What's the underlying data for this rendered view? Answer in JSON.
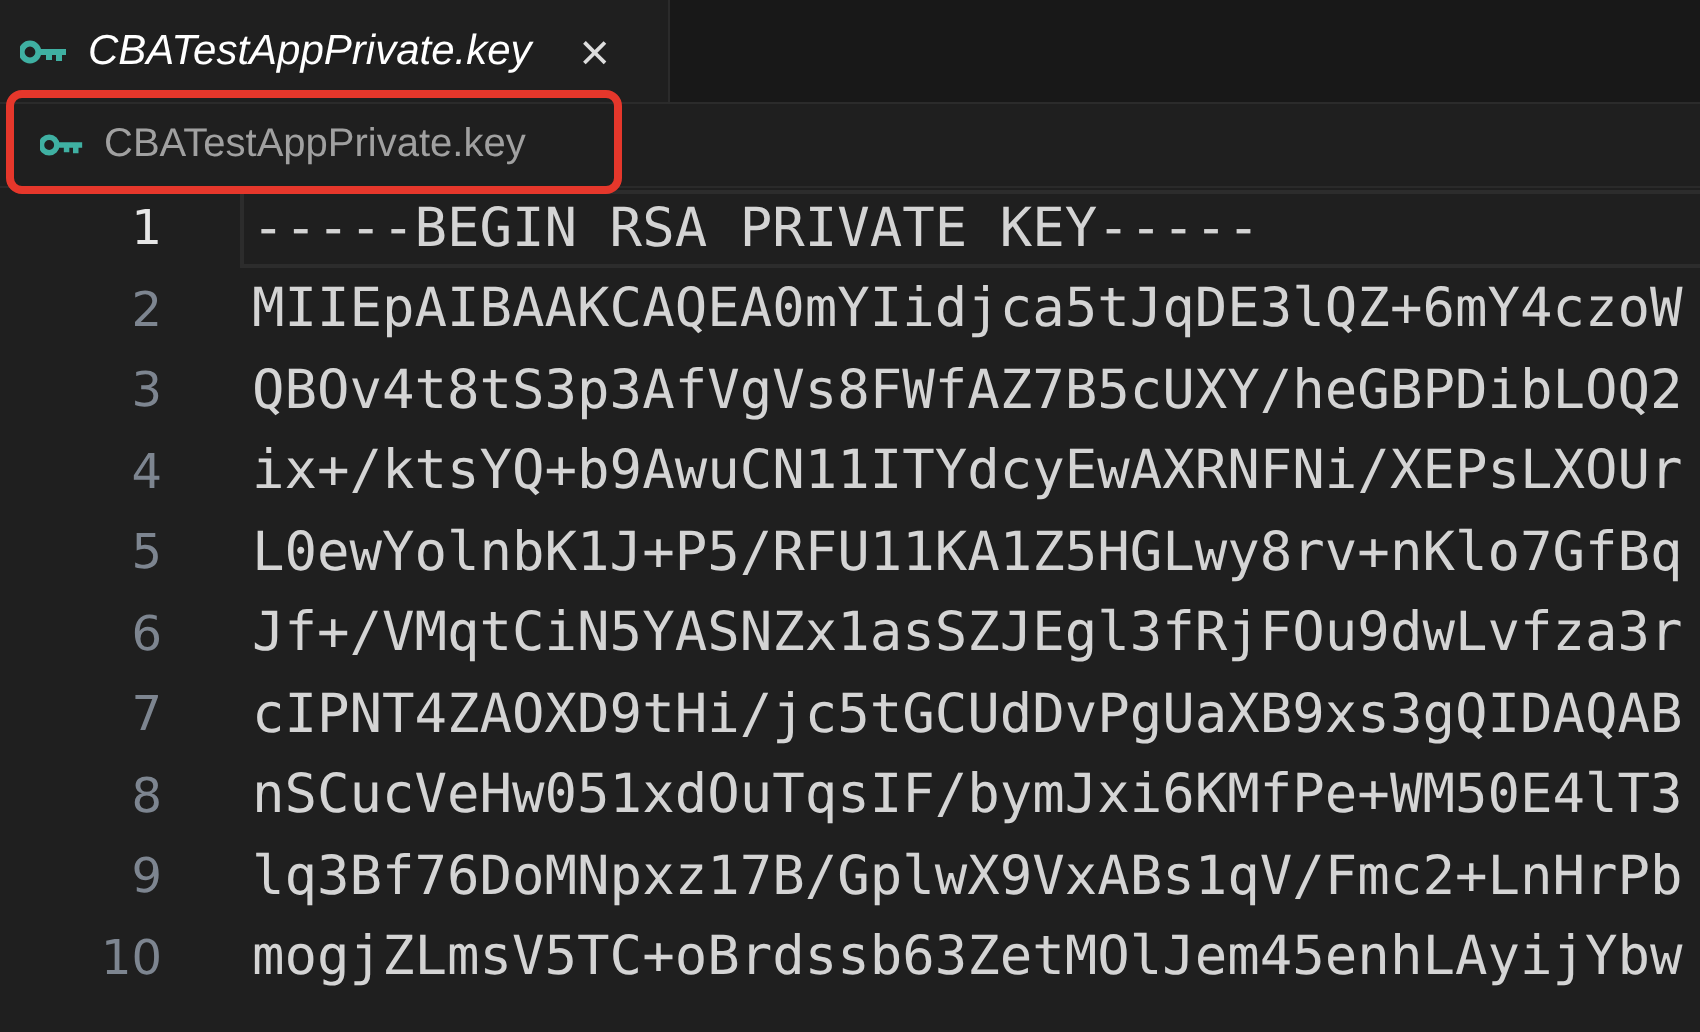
{
  "tabs": [
    {
      "label": "CBATestAppPrivate.key",
      "selected": true,
      "close": "×"
    }
  ],
  "breadcrumb": {
    "label": "CBATestAppPrivate.key",
    "highlighted": true
  },
  "editor": {
    "lines": [
      {
        "number": "1",
        "text": "-----BEGIN RSA PRIVATE KEY-----",
        "current": true
      },
      {
        "number": "2",
        "text": "MIIEpAIBAAKCAQEA0mYIidjca5tJqDE3lQZ+6mY4czoW",
        "current": false
      },
      {
        "number": "3",
        "text": "QBOv4t8tS3p3AfVgVs8FWfAZ7B5cUXY/heGBPDibLOQ2",
        "current": false
      },
      {
        "number": "4",
        "text": "ix+/ktsYQ+b9AwuCN11ITYdcyEwAXRNFNi/XEPsLXOUr",
        "current": false
      },
      {
        "number": "5",
        "text": "L0ewYolnbK1J+P5/RFU11KA1Z5HGLwy8rv+nKlo7GfBq",
        "current": false
      },
      {
        "number": "6",
        "text": "Jf+/VMqtCiN5YASNZx1asSZJEgl3fRjFOu9dwLvfza3r",
        "current": false
      },
      {
        "number": "7",
        "text": "cIPNT4ZAOXD9tHi/jc5tGCUdDvPgUaXB9xs3gQIDAQAB",
        "current": false
      },
      {
        "number": "8",
        "text": "nSCucVeHw051xdOuTqsIF/bymJxi6KMfPe+WM50E4lT3",
        "current": false
      },
      {
        "number": "9",
        "text": "lq3Bf76DoMNpxz17B/GplwX9VxABs1qV/Fmc2+LnHrPb",
        "current": false
      },
      {
        "number": "10",
        "text": "mogjZLmsV5TC+oBrdssb63ZetMOlJem45enhLAyijYbw",
        "current": false
      }
    ]
  }
}
